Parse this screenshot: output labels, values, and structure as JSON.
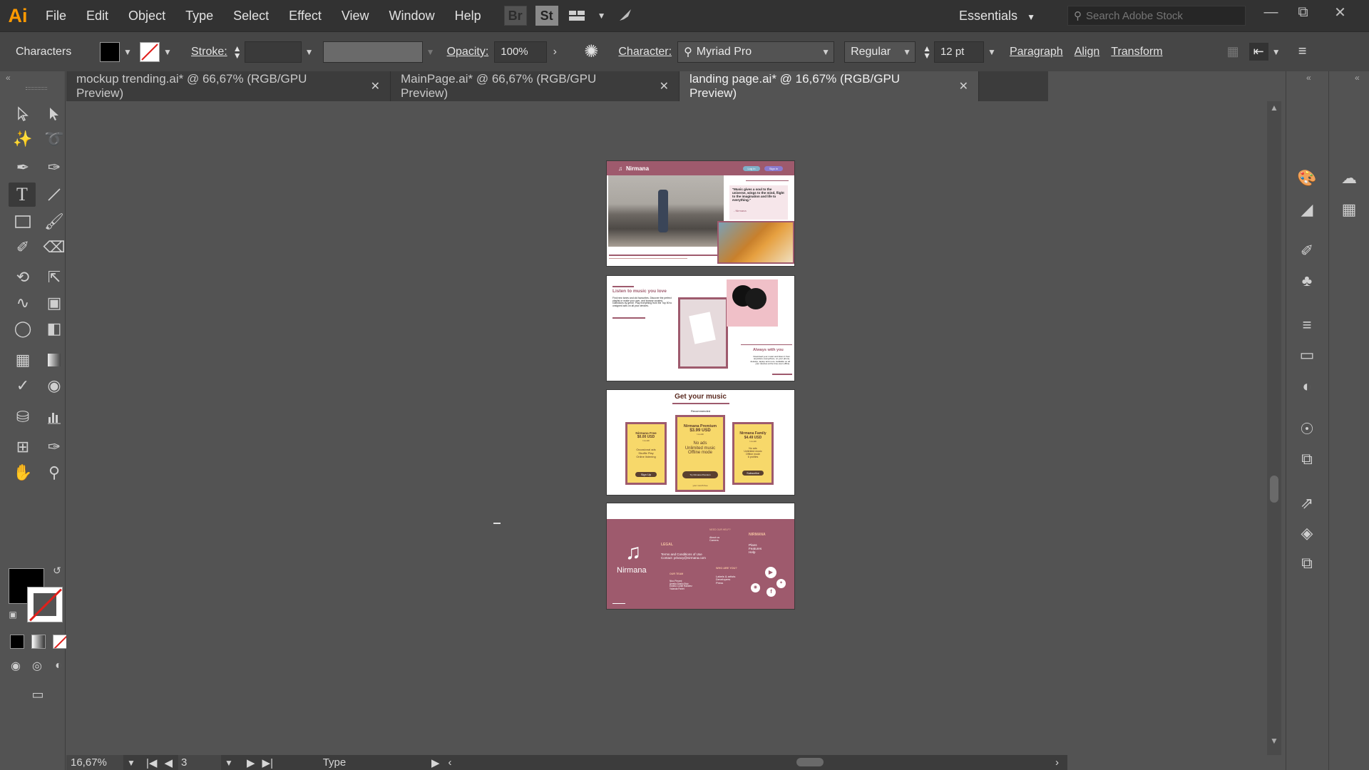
{
  "app": {
    "logo": "Ai",
    "menu": [
      "File",
      "Edit",
      "Object",
      "Type",
      "Select",
      "Effect",
      "View",
      "Window",
      "Help"
    ],
    "bridge_label": "Br",
    "stock_label": "St",
    "workspace": "Essentials",
    "search_placeholder": "Search Adobe Stock"
  },
  "control_bar": {
    "panel_name": "Characters",
    "stroke_label": "Stroke:",
    "opacity_label": "Opacity:",
    "opacity_value": "100%",
    "character_label": "Character:",
    "font_family": "Myriad Pro",
    "font_style": "Regular",
    "font_size": "12 pt",
    "paragraph_label": "Paragraph",
    "align_label": "Align",
    "transform_label": "Transform"
  },
  "tabs": [
    {
      "label": "mockup trending.ai* @ 66,67% (RGB/GPU Preview)"
    },
    {
      "label": "MainPage.ai* @ 66,67% (RGB/GPU Preview)"
    },
    {
      "label": "landing page.ai* @ 16,67% (RGB/GPU Preview)"
    }
  ],
  "status": {
    "zoom": "16,67%",
    "artboard_number": "3",
    "current_tool": "Type"
  },
  "artboards": {
    "hero": {
      "brand": "Nirmana",
      "login": "Log in",
      "signin": "Sign in",
      "quote": "\"Music gives a soul to the universe, wings to the mind, flight to the imagination and life to everything.\"",
      "quote_author": "- Nirmana"
    },
    "features": {
      "heading": "Listen to music you love",
      "body": "Find new tones and old favourites. Discover the perfect playlist or make your own, and browse curated collections by genre. Play everything from the Top 50 to unsigned acts on all your devices.",
      "heading2": "Always with you",
      "body2": "Download your music and listen it from anywhere everywhere, on your phone, desktop, laptop and more. Available on all your devices at the time even offline."
    },
    "pricing": {
      "heading": "Get your music",
      "recommended": "Recommended",
      "plans": [
        {
          "name": "Nirmana Free",
          "price": "$0.00 USD",
          "period": "/ month",
          "features": "Occasional ads\nShuffle Play\nOnline listening",
          "button": "Sign Up"
        },
        {
          "name": "Nirmana Premium",
          "price": "$3.99 USD",
          "period": "/ month",
          "features": "No ads\nUnlimited music\nOffline mode",
          "button": "Try Nirmana Premium",
          "note": "your month free"
        },
        {
          "name": "Nirmana Family",
          "price": "$4.49 USD",
          "period": "/ month",
          "features": "No ads\nUnlimited music\nOffline mode\n6 profiles",
          "button": "Subscribe"
        }
      ]
    },
    "footer": {
      "brand": "Nirmana",
      "legal_title": "LEGAL",
      "legal_text": "Terms and Conditions of Use\nContact: privacy@nirmana.com",
      "need_help": "NEED OUR HELP?",
      "about": "About us\nCareers",
      "nirmana_title": "NIRMANA",
      "nirmana_links": "Plans\nFeatures\nHelp",
      "team_title": "OUR TEAM",
      "team": "Nico Pirrami\nAmelia Shallo Ruiz\nEmelio Cortel Ramirez\nYolanda Parlet",
      "who_title": "WHO ARE YOU?",
      "who_links": "Labels & artists\nDevelopers\nPress"
    }
  },
  "colors": {
    "accent": "#9e5a6d",
    "price_card": "#f7d86a",
    "ai_orange": "#ff9a00",
    "stroke_none_red": "#e0201c"
  }
}
